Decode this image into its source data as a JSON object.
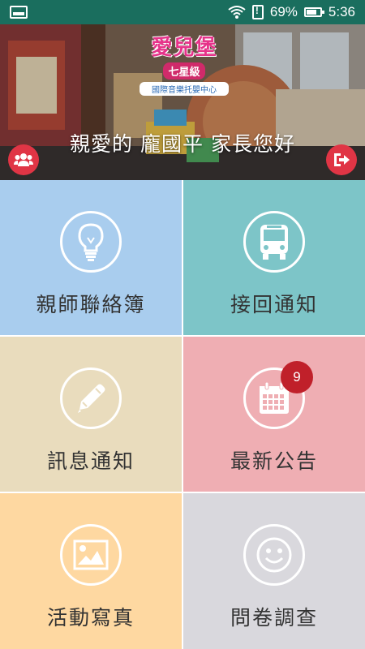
{
  "status_bar": {
    "battery_percent": "69%",
    "time": "5:36"
  },
  "header": {
    "logo": {
      "main": "愛兒堡",
      "sub": "七星級",
      "line": "國際音樂托嬰中心"
    },
    "greeting": "親愛的 龐國平 家長您好"
  },
  "menu": {
    "tiles": [
      {
        "label": "親師聯絡簿",
        "color": "#a9cdee"
      },
      {
        "label": "接回通知",
        "color": "#7dc5c8"
      },
      {
        "label": "訊息通知",
        "color": "#e9dcbd"
      },
      {
        "label": "最新公告",
        "color": "#efaeb3",
        "badge": "9"
      },
      {
        "label": "活動寫真",
        "color": "#fed8a1"
      },
      {
        "label": "問卷調查",
        "color": "#d9d8dd"
      }
    ]
  },
  "colors": {
    "status_bar": "#1a6e5e",
    "header_button": "#e03545",
    "badge": "#c0202a"
  }
}
